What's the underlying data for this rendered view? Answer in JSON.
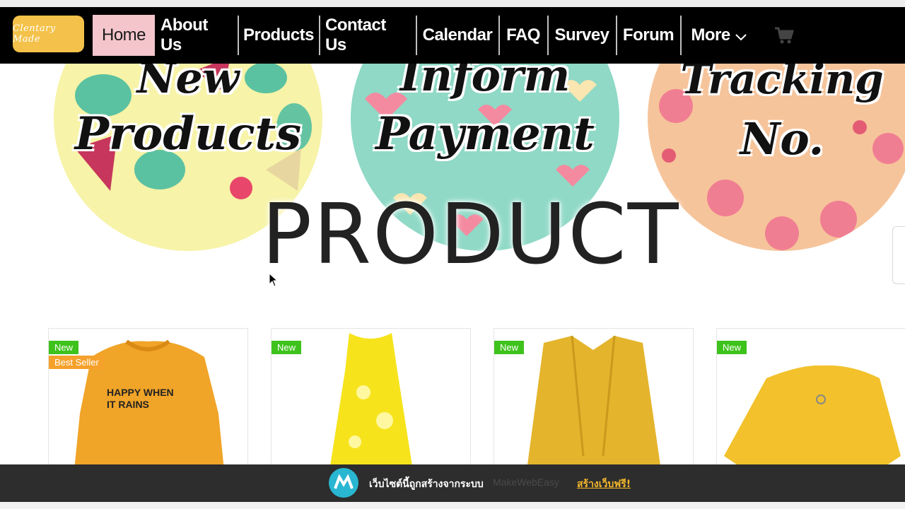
{
  "brand": {
    "logo_text": "Clentary Made",
    "accent": "#f4c24a"
  },
  "nav": {
    "items": [
      {
        "label": "Home",
        "active": true
      },
      {
        "label": "About Us"
      },
      {
        "label": "Products"
      },
      {
        "label": "Contact Us"
      },
      {
        "label": "Calendar"
      },
      {
        "label": "FAQ"
      },
      {
        "label": "Survey"
      },
      {
        "label": "Forum"
      },
      {
        "label": "More"
      }
    ],
    "more_icon": "chevron-down-icon",
    "cart_icon": "cart-icon",
    "active_bg": "#f4c6cc"
  },
  "banner": {
    "circles": [
      {
        "line1": "New",
        "line2": "Products",
        "bg": "#f7f3a8"
      },
      {
        "line1": "Inform",
        "line2": "Payment",
        "bg": "#8fd9c6"
      },
      {
        "line1": "Tracking",
        "line2": "No.",
        "bg": "#f6c49b"
      }
    ],
    "heading": "PRODUCT"
  },
  "products": [
    {
      "badges": [
        "New",
        "Best Seller"
      ],
      "print_text_1": "HAPPY WHEN",
      "print_text_2": "IT RAINS",
      "color": "#f0a428"
    },
    {
      "badges": [
        "New"
      ],
      "color": "#f6e31c"
    },
    {
      "badges": [
        "New"
      ],
      "color": "#e4b42c"
    },
    {
      "badges": [
        "New"
      ],
      "color": "#f2c12b"
    }
  ],
  "footer": {
    "text": "เว็บไซต์นี้ถูกสร้างจากระบบ",
    "brand": "MakeWebEasy",
    "cta": "สร้างเว็บฟรี!"
  }
}
